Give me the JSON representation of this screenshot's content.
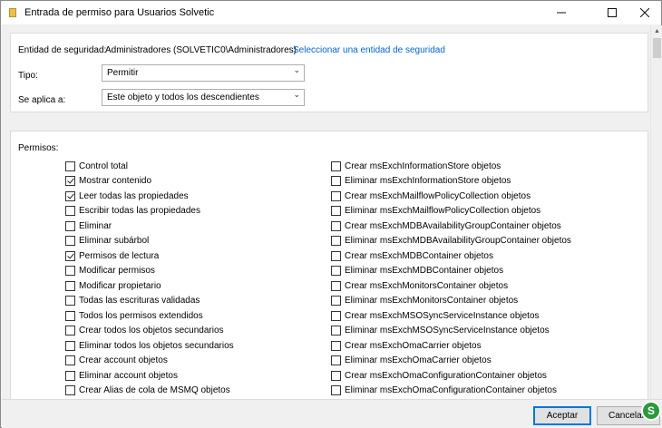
{
  "window": {
    "title": "Entrada de permiso para Usuarios Solvetic",
    "minimize_icon": "minimize-icon",
    "maximize_icon": "maximize-icon",
    "close_icon": "close-icon"
  },
  "principal": {
    "label": "Entidad de seguridad:",
    "value": "Administradores (SOLVETIC0\\Administradores)",
    "select_link": "Seleccionar una entidad de seguridad"
  },
  "type": {
    "label": "Tipo:",
    "value": "Permitir"
  },
  "applies_to": {
    "label": "Se aplica a:",
    "value": "Este objeto y todos los descendientes"
  },
  "permissions": {
    "label": "Permisos:",
    "left": [
      {
        "label": "Control total",
        "checked": false
      },
      {
        "label": "Mostrar contenido",
        "checked": true
      },
      {
        "label": "Leer todas las propiedades",
        "checked": true
      },
      {
        "label": "Escribir todas las propiedades",
        "checked": false
      },
      {
        "label": "Eliminar",
        "checked": false
      },
      {
        "label": "Eliminar subárbol",
        "checked": false
      },
      {
        "label": "Permisos de lectura",
        "checked": true
      },
      {
        "label": "Modificar permisos",
        "checked": false
      },
      {
        "label": "Modificar propietario",
        "checked": false
      },
      {
        "label": "Todas las escrituras validadas",
        "checked": false
      },
      {
        "label": "Todos los permisos extendidos",
        "checked": false
      },
      {
        "label": "Crear todos los objetos secundarios",
        "checked": false
      },
      {
        "label": "Eliminar todos los objetos secundarios",
        "checked": false
      },
      {
        "label": "Crear account objetos",
        "checked": false
      },
      {
        "label": "Eliminar account objetos",
        "checked": false
      },
      {
        "label": "Crear Alias de cola de MSMQ objetos",
        "checked": false
      }
    ],
    "right": [
      {
        "label": "Crear msExchInformationStore objetos",
        "checked": false
      },
      {
        "label": "Eliminar msExchInformationStore objetos",
        "checked": false
      },
      {
        "label": "Crear msExchMailflowPolicyCollection objetos",
        "checked": false
      },
      {
        "label": "Eliminar msExchMailflowPolicyCollection objetos",
        "checked": false
      },
      {
        "label": "Crear msExchMDBAvailabilityGroupContainer objetos",
        "checked": false
      },
      {
        "label": "Eliminar msExchMDBAvailabilityGroupContainer objetos",
        "checked": false
      },
      {
        "label": "Crear msExchMDBContainer objetos",
        "checked": false
      },
      {
        "label": "Eliminar msExchMDBContainer objetos",
        "checked": false
      },
      {
        "label": "Crear msExchMonitorsContainer objetos",
        "checked": false
      },
      {
        "label": "Eliminar msExchMonitorsContainer objetos",
        "checked": false
      },
      {
        "label": "Crear msExchMSOSyncServiceInstance objetos",
        "checked": false
      },
      {
        "label": "Eliminar msExchMSOSyncServiceInstance objetos",
        "checked": false
      },
      {
        "label": "Crear msExchOmaCarrier objetos",
        "checked": false
      },
      {
        "label": "Eliminar msExchOmaCarrier objetos",
        "checked": false
      },
      {
        "label": "Crear msExchOmaConfigurationContainer objetos",
        "checked": false
      },
      {
        "label": "Eliminar msExchOmaConfigurationContainer objetos",
        "checked": false
      }
    ]
  },
  "footer": {
    "accept_label": "Aceptar",
    "cancel_label": "Cancelar"
  },
  "colors": {
    "link": "#0066cc",
    "primary_border": "#0078d7",
    "logo": "#2a9a3c"
  }
}
